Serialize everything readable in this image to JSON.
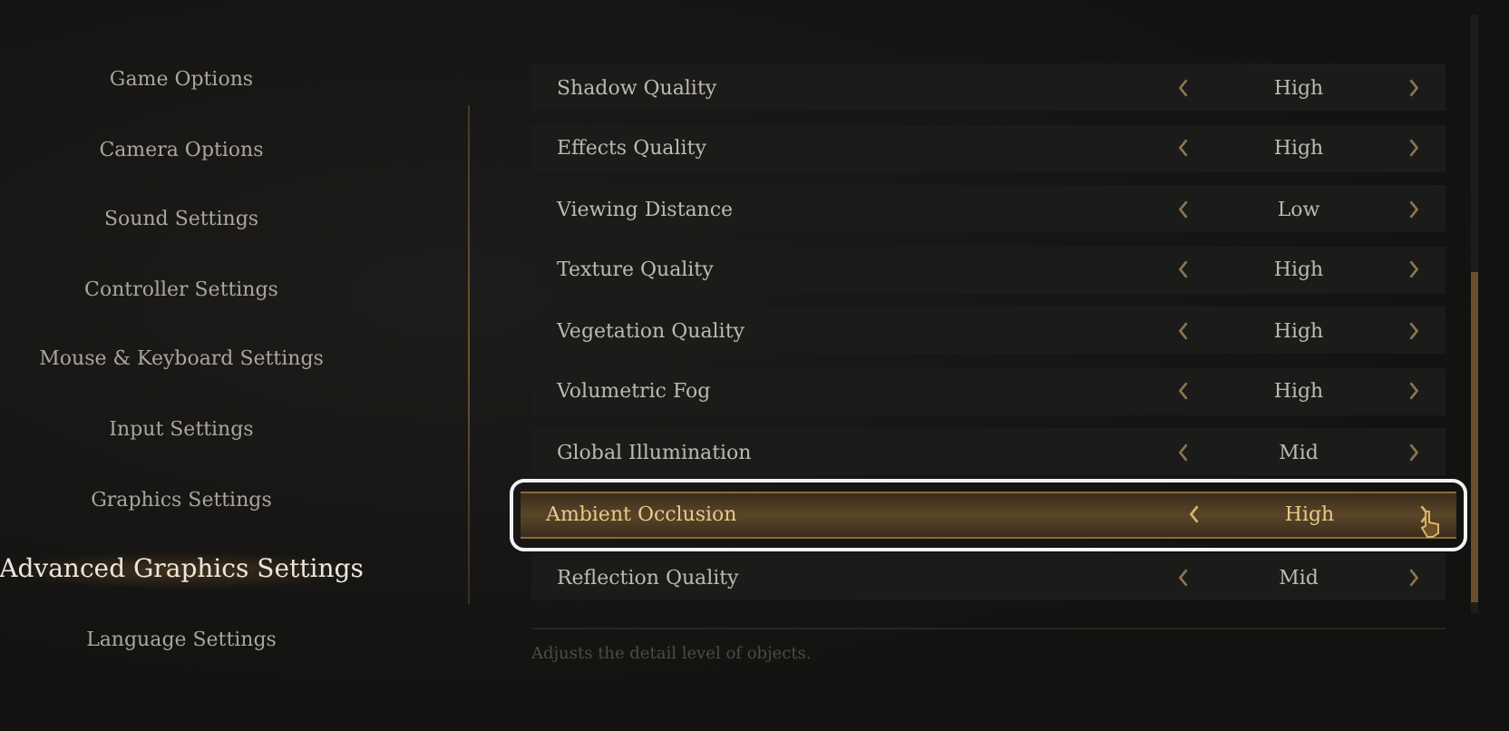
{
  "sidebar": {
    "items": [
      {
        "label": "Game Options",
        "selected": false
      },
      {
        "label": "Camera Options",
        "selected": false
      },
      {
        "label": "Sound Settings",
        "selected": false
      },
      {
        "label": "Controller Settings",
        "selected": false
      },
      {
        "label": "Mouse & Keyboard Settings",
        "selected": false
      },
      {
        "label": "Input Settings",
        "selected": false
      },
      {
        "label": "Graphics Settings",
        "selected": false
      },
      {
        "label": "Advanced Graphics Settings",
        "selected": true
      },
      {
        "label": "Language Settings",
        "selected": false
      }
    ]
  },
  "settings": {
    "rows": [
      {
        "name": "Shadow Quality",
        "value": "High",
        "selected": false
      },
      {
        "name": "Effects Quality",
        "value": "High",
        "selected": false
      },
      {
        "name": "Viewing Distance",
        "value": "Low",
        "selected": false
      },
      {
        "name": "Texture Quality",
        "value": "High",
        "selected": false
      },
      {
        "name": "Vegetation Quality",
        "value": "High",
        "selected": false
      },
      {
        "name": "Volumetric Fog",
        "value": "High",
        "selected": false
      },
      {
        "name": "Global Illumination",
        "value": "Mid",
        "selected": false
      },
      {
        "name": "Ambient Occlusion",
        "value": "High",
        "selected": true
      },
      {
        "name": "Reflection Quality",
        "value": "Mid",
        "selected": false
      }
    ],
    "description": "Adjusts the detail level of objects."
  }
}
